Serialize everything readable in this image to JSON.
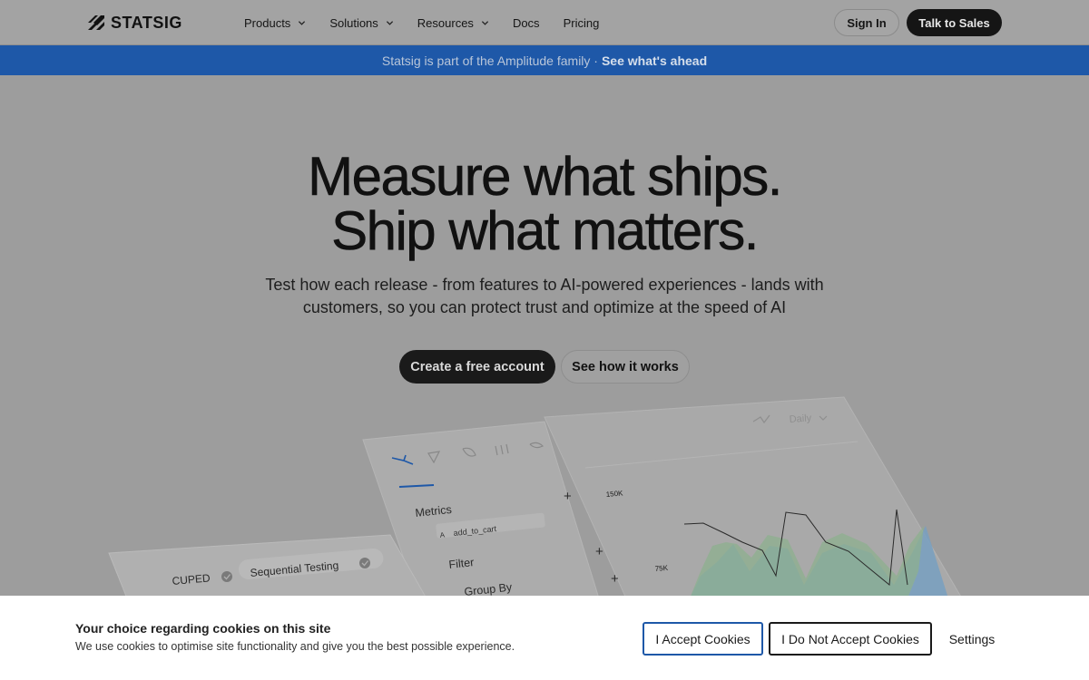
{
  "brand": {
    "name": "STATSIG"
  },
  "nav": {
    "items": [
      {
        "label": "Products",
        "has_dropdown": true
      },
      {
        "label": "Solutions",
        "has_dropdown": true
      },
      {
        "label": "Resources",
        "has_dropdown": true
      },
      {
        "label": "Docs",
        "has_dropdown": false
      },
      {
        "label": "Pricing",
        "has_dropdown": false
      }
    ],
    "sign_in": "Sign In",
    "talk_to_sales": "Talk to Sales"
  },
  "banner": {
    "text": "Statsig is part of the Amplitude family ·",
    "link": "See what's ahead",
    "color": "#1e58a8"
  },
  "hero": {
    "title_line1": "Measure what ships.",
    "title_line2": "Ship what matters.",
    "subtitle": "Test how each release - from features to AI-powered experiences - lands with customers, so you can protect trust and optimize at the speed of AI",
    "primary_cta": "Create a free account",
    "secondary_cta": "See how it works"
  },
  "illustration": {
    "toggles": [
      "CUPED",
      "Sequential Testing"
    ],
    "panel_labels": [
      "Metrics",
      "Filter",
      "Group By"
    ],
    "metric_chip_letter": "A",
    "metric_chip": "add_to_cart",
    "granularity": "Daily",
    "y_ticks": [
      "150K",
      "75K"
    ]
  },
  "cookie": {
    "title": "Your choice regarding cookies on this site",
    "description": "We use cookies to optimise site functionality and give you the best possible experience.",
    "accept": "I Accept Cookies",
    "deny": "I Do Not Accept Cookies",
    "settings": "Settings"
  }
}
